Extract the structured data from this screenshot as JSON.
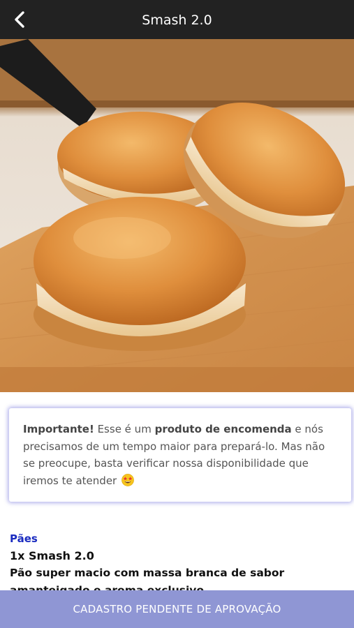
{
  "header": {
    "title": "Smash 2.0",
    "back_icon": "chevron-left-icon"
  },
  "hero": {
    "alt": "Smash 2.0"
  },
  "notice": {
    "bold_label": "Importante!",
    "text_1": " Esse é um ",
    "bold_product": "produto de encomenda",
    "text_2": " e nós precisamos de um tempo maior para prepará-lo. Mas não se preocupe, basta verificar nossa disponibilidade que iremos te atender ",
    "emoji_icon": "star-struck-emoji-icon"
  },
  "product": {
    "category": "Pães",
    "name": "1x Smash 2.0",
    "description": "Pão super macio com massa branca de sabor amanteigado e aroma exclusivo"
  },
  "footer": {
    "status_button_label": "CADASTRO PENDENTE DE APROVAÇÃO"
  },
  "colors": {
    "topbar": "#222222",
    "accent_blue": "#1a2bc0",
    "footer_bar": "#8f96d4"
  }
}
